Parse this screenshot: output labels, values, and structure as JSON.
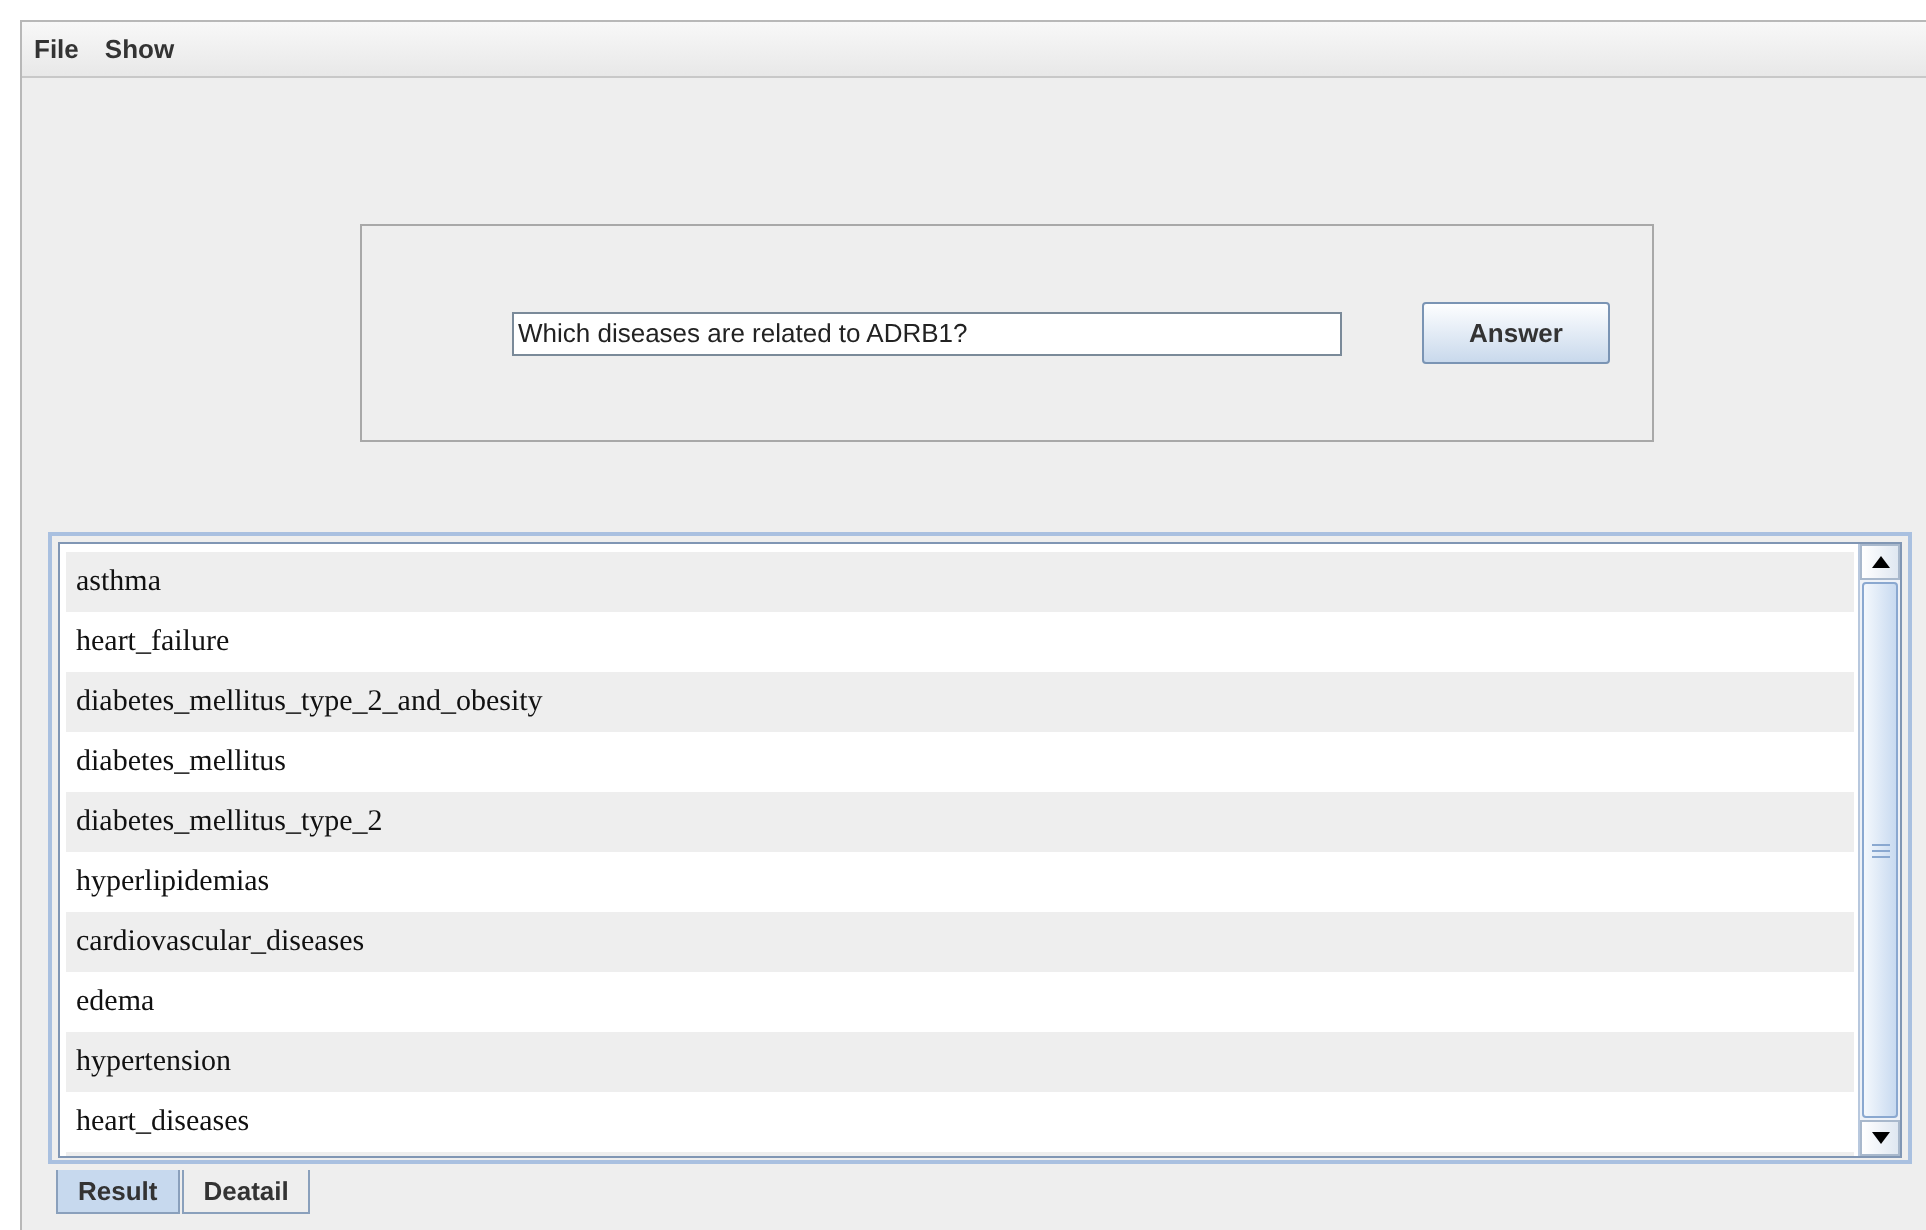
{
  "menu": [
    {
      "label": "File"
    },
    {
      "label": "Show"
    }
  ],
  "query": {
    "value": "Which diseases are related to ADRB1?"
  },
  "answer_button": {
    "label": "Answer"
  },
  "results": [
    "asthma",
    "heart_failure",
    "diabetes_mellitus_type_2_and_obesity",
    "diabetes_mellitus",
    "diabetes_mellitus_type_2",
    "hyperlipidemias",
    "cardiovascular_diseases",
    "edema",
    "hypertension",
    "heart_diseases"
  ],
  "tabs": [
    {
      "label": "Result",
      "selected": true
    },
    {
      "label": "Deatail",
      "selected": false
    }
  ]
}
